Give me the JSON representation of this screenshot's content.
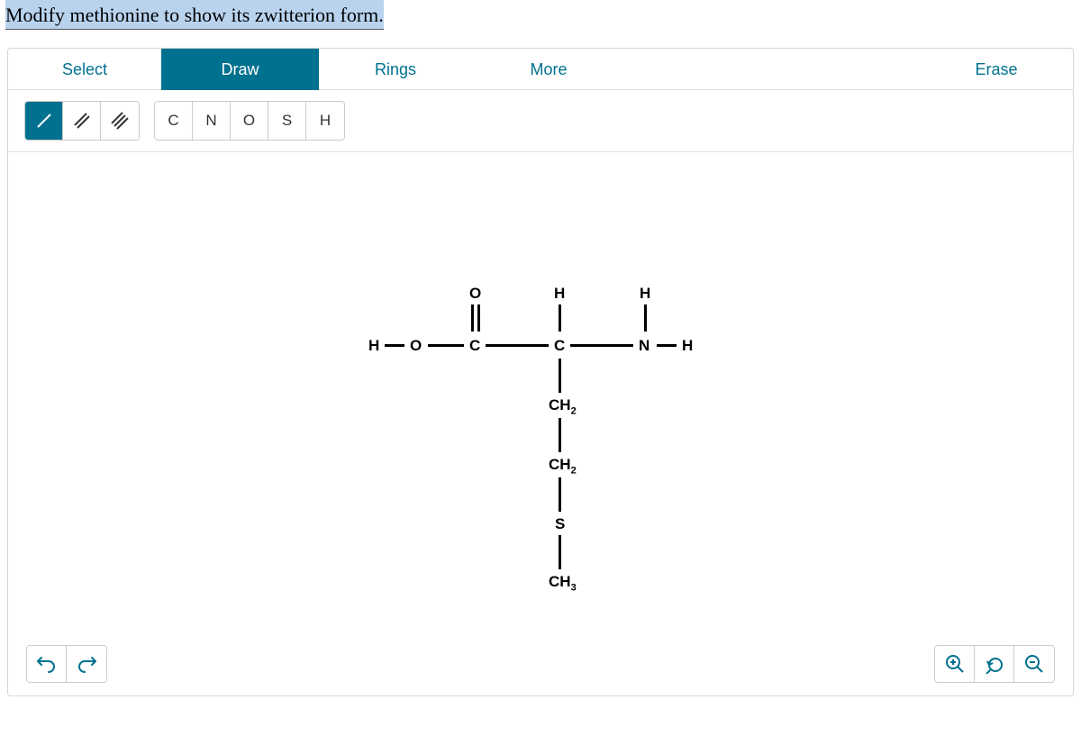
{
  "question": "Modify methionine to show its zwitterion form.",
  "tabs": {
    "select": "Select",
    "draw": "Draw",
    "rings": "Rings",
    "more": "More",
    "erase": "Erase"
  },
  "bond_tools": {
    "single": "/",
    "double": "//",
    "triple": "///"
  },
  "atom_tools": {
    "c": "C",
    "n": "N",
    "o": "O",
    "s": "S",
    "h": "H"
  },
  "structure": {
    "atoms": {
      "H_left": "H",
      "O_hydroxyl": "O",
      "C_carboxyl": "C",
      "O_dbl": "O",
      "C_alpha": "C",
      "H_alpha": "H",
      "N": "N",
      "H_n_top": "H",
      "H_n_right": "H",
      "CH2_1": "CH",
      "CH2_1_sub": "2",
      "CH2_2": "CH",
      "CH2_2_sub": "2",
      "S": "S",
      "CH3": "CH",
      "CH3_sub": "3"
    }
  },
  "controls": {
    "undo": "undo",
    "redo": "redo",
    "zoom_in": "zoom-in",
    "zoom_reset": "zoom-reset",
    "zoom_out": "zoom-out"
  }
}
